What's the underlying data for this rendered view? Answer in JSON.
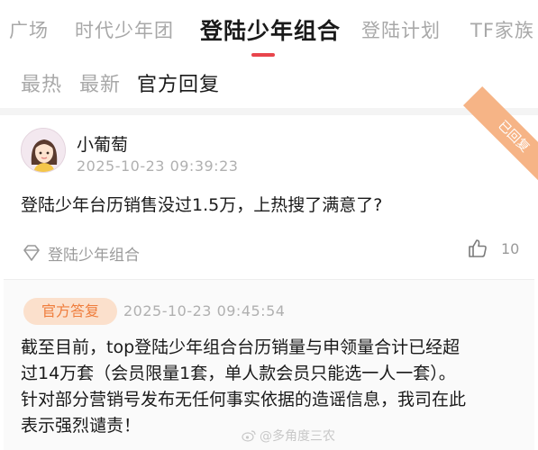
{
  "top_tabs": [
    "广场",
    "时代少年团",
    "登陆少年组合",
    "登陆计划",
    "TF家族"
  ],
  "sub_tabs": [
    "最热",
    "最新",
    "官方回复"
  ],
  "post": {
    "username": "小葡萄",
    "time": "2025-10-23 09:39:23",
    "text": "登陆少年台历销售没过1.5万，上热搜了满意了?",
    "topic": "登陆少年组合",
    "likes": "10",
    "ribbon": "已回复"
  },
  "reply": {
    "badge": "官方答复",
    "time": "2025-10-23 09:45:54",
    "lines": [
      "截至目前，top登陆少年组合台历销量与申领量合计已经超",
      "过14万套（会员限量1套，单人款会员只能选一人一套）。",
      "针对部分营销号发布无任何事实依据的造谣信息，我司在此",
      "表示强烈谴责！"
    ]
  },
  "watermark": "@多角度三农",
  "colors": {
    "accent": "#e8454c",
    "ribbon": "#f6b486",
    "badge_bg": "#fbe0cc",
    "badge_text": "#ef7d3c"
  }
}
